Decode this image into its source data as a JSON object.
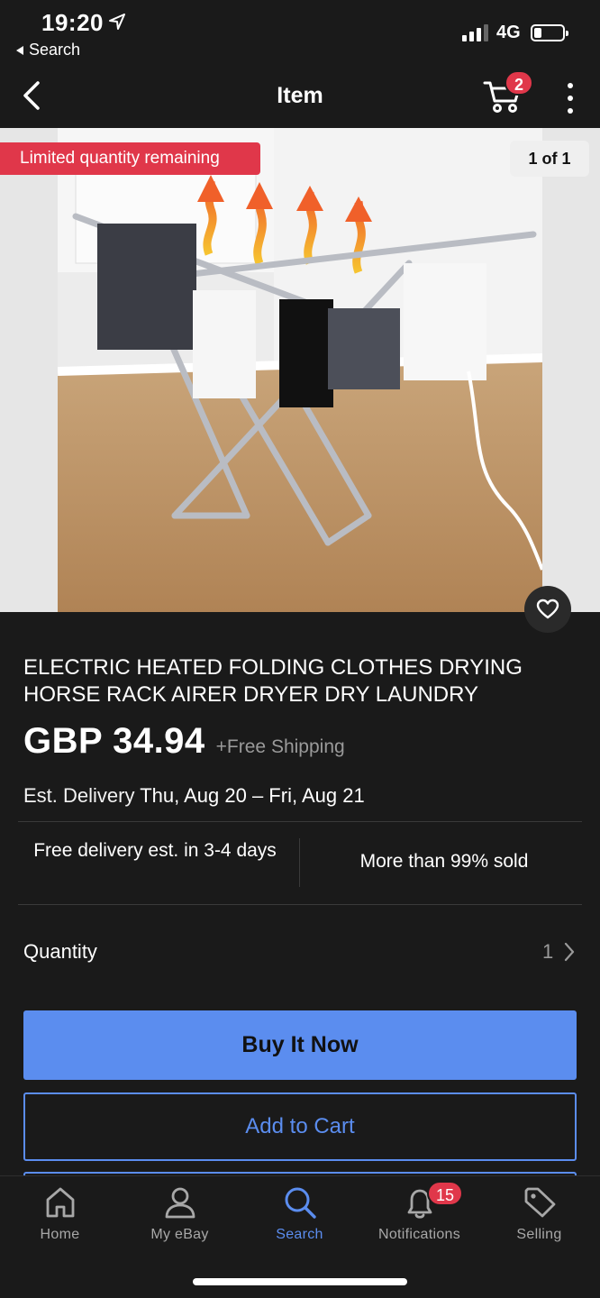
{
  "status_bar": {
    "time": "19:20",
    "back_app": "Search",
    "network": "4G"
  },
  "nav": {
    "title": "Item",
    "cart_count": "2"
  },
  "gallery": {
    "badge": "Limited quantity remaining",
    "counter": "1 of 1"
  },
  "listing": {
    "title": "ELECTRIC HEATED FOLDING CLOTHES DRYING HORSE RACK AIRER DRYER DRY LAUNDRY",
    "price": "GBP 34.94",
    "shipping": "+Free Shipping",
    "delivery_label": "Est. Delivery",
    "delivery_dates": "Thu, Aug 20 – Fri, Aug 21",
    "free_delivery": "Free delivery est. in 3-4 days",
    "sold_info": "More than 99% sold",
    "quantity_label": "Quantity",
    "quantity_value": "1"
  },
  "actions": {
    "buy_now": "Buy It Now",
    "add_to_cart": "Add to Cart"
  },
  "tab_bar": {
    "items": [
      {
        "label": "Home",
        "icon": "home-icon"
      },
      {
        "label": "My eBay",
        "icon": "person-icon"
      },
      {
        "label": "Search",
        "icon": "search-icon"
      },
      {
        "label": "Notifications",
        "icon": "bell-icon"
      },
      {
        "label": "Selling",
        "icon": "tag-icon"
      }
    ],
    "notifications_count": "15",
    "active": "Search"
  },
  "colors": {
    "accent": "#5b8def",
    "badge": "#e0374a",
    "background": "#1a1a1a"
  }
}
